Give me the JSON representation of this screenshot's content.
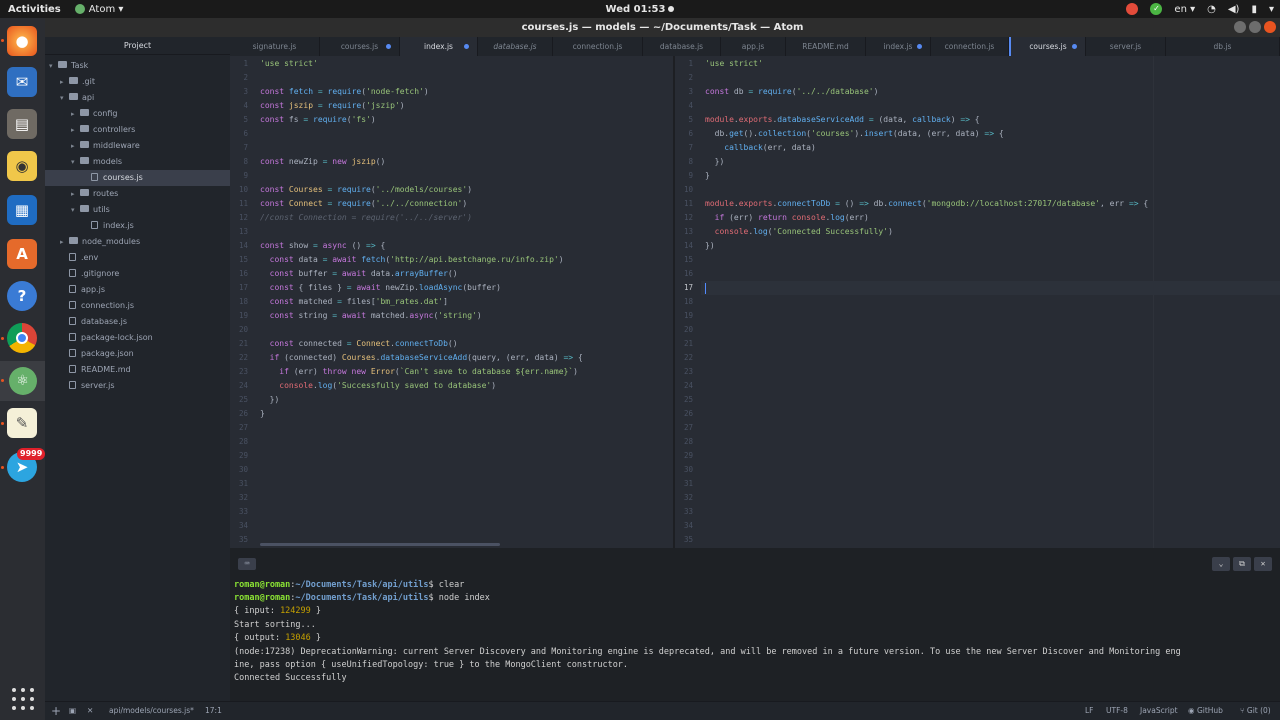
{
  "topbar": {
    "activities": "Activities",
    "app_name": "Atom",
    "datetime": "Wed 01:53",
    "lang": "en"
  },
  "dock": {
    "telegram_badge": "9999",
    "items": [
      "firefox-icon",
      "thunderbird-icon",
      "files-icon",
      "rhythmbox-icon",
      "writer-icon",
      "software-center-icon",
      "help-icon",
      "chrome-icon",
      "atom-icon",
      "text-editor-icon",
      "telegram-icon"
    ]
  },
  "window": {
    "title": "courses.js — models — ~/Documents/Task — Atom"
  },
  "tree": {
    "header": "Project",
    "items": [
      {
        "label": "Task",
        "type": "folder"
      },
      {
        "label": ".git",
        "type": "folder"
      },
      {
        "label": "api",
        "type": "folder"
      },
      {
        "label": "config",
        "type": "folder"
      },
      {
        "label": "controllers",
        "type": "folder"
      },
      {
        "label": "middleware",
        "type": "folder"
      },
      {
        "label": "models",
        "type": "folder"
      },
      {
        "label": "courses.js",
        "type": "file"
      },
      {
        "label": "routes",
        "type": "folder"
      },
      {
        "label": "utils",
        "type": "folder"
      },
      {
        "label": "index.js",
        "type": "file"
      },
      {
        "label": "node_modules",
        "type": "folder"
      },
      {
        "label": ".env",
        "type": "file"
      },
      {
        "label": ".gitignore",
        "type": "file"
      },
      {
        "label": "app.js",
        "type": "file"
      },
      {
        "label": "connection.js",
        "type": "file"
      },
      {
        "label": "database.js",
        "type": "file"
      },
      {
        "label": "package-lock.json",
        "type": "file"
      },
      {
        "label": "package.json",
        "type": "file"
      },
      {
        "label": "README.md",
        "type": "file"
      },
      {
        "label": "server.js",
        "type": "file"
      }
    ]
  },
  "tabs": [
    {
      "label": "signature.js"
    },
    {
      "label": "courses.js",
      "modified": true
    },
    {
      "label": "index.js",
      "modified": true
    },
    {
      "label": "database.js"
    },
    {
      "label": "connection.js"
    },
    {
      "label": "database.js"
    },
    {
      "label": "app.js"
    },
    {
      "label": "README.md"
    },
    {
      "label": "index.js",
      "modified": true
    },
    {
      "label": "connection.js"
    },
    {
      "label": "courses.js",
      "modified": true
    },
    {
      "label": "server.js"
    },
    {
      "label": "db.js"
    }
  ],
  "editor_left": {
    "line_count": 35,
    "lines": {
      "1": "'use strict'",
      "3": "const fetch = require('node-fetch')",
      "4": "const jszip = require('jszip')",
      "5": "const fs = require('fs')",
      "8": "const newZip = new jszip()",
      "10": "const Courses = require('../models/courses')",
      "11": "const Connect = require('../../connection')",
      "12": "//const Connection = require('../../server')",
      "14": "const show = async () => {",
      "15": "  const data = await fetch('http://api.bestchange.ru/info.zip')",
      "16": "  const buffer = await data.arrayBuffer()",
      "17": "  const { files } = await newZip.loadAsync(buffer)",
      "18": "  const matched = files['bm_rates.dat']",
      "19": "  const string = await matched.async('string')",
      "21": "  const connected = Connect.connectToDb()",
      "22": "  if (connected) Courses.databaseServiceAdd(query, (err, data) => {",
      "23": "    if (err) throw new Error(`Can't save to database ${err.name}`)",
      "24": "    console.log('Successfully saved to database')",
      "25": "  })",
      "26": "}"
    }
  },
  "editor_right": {
    "line_count": 35,
    "cursor_line": 17,
    "lines": {
      "1": "'use strict'",
      "3": "const db = require('../../database')",
      "5": "module.exports.databaseServiceAdd = (data, callback) => {",
      "6": "  db.get().collection('courses').insert(data, (err, data) => {",
      "7": "    callback(err, data)",
      "8": "  })",
      "9": "}",
      "11": "module.exports.connectToDb = () => db.connect('mongodb://localhost:27017/database', err => {",
      "12": "  if (err) return console.log(err)",
      "13": "  console.log('Connected Successfully')",
      "14": "})"
    }
  },
  "terminal": {
    "user": "roman@roman",
    "path": "~/Documents/Task/api/utils",
    "cmd1": "clear",
    "cmd2": "node index",
    "input_label": "{ input: ",
    "input_value": "124299",
    "input_close": " }",
    "sorting": "Start sorting...",
    "output_label": "{ output: ",
    "output_value": "13046",
    "output_close": " }",
    "warning1": "(node:17238) DeprecationWarning: current Server Discovery and Monitoring engine is deprecated, and will be removed in a future version. To use the new Server Discover and Monitoring eng",
    "warning2": "ine, pass option { useUnifiedTopology: true } to the MongoClient constructor.",
    "connected": "Connected Successfully"
  },
  "statusbar": {
    "file_path": "api/models/courses.js*",
    "cursor_pos": "17:1",
    "line_ending": "LF",
    "encoding": "UTF-8",
    "grammar": "JavaScript",
    "github": "GitHub",
    "git": "Git (0)"
  },
  "colors": {
    "accent": "#578af2",
    "ubuntu_orange": "#e95420",
    "editor_bg": "#282c34"
  }
}
